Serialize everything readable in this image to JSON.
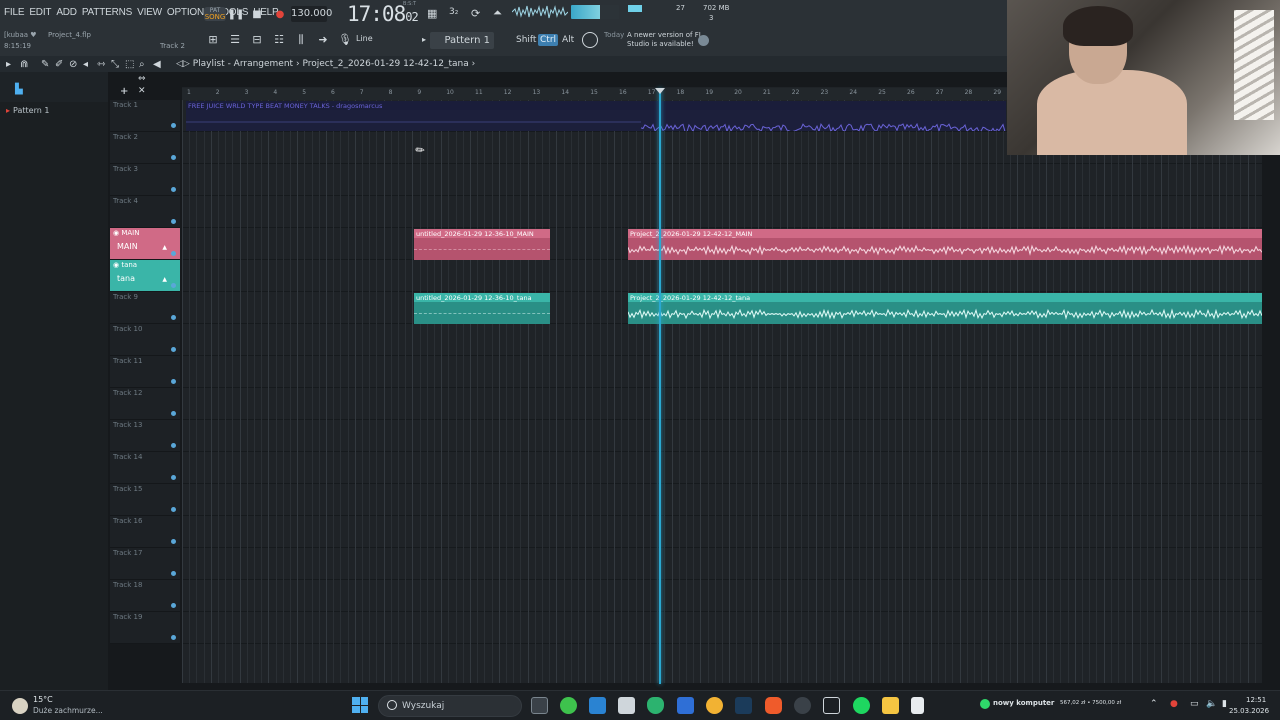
{
  "menu": [
    "FILE",
    "EDIT",
    "ADD",
    "PATTERNS",
    "VIEW",
    "OPTIONS",
    "TOOLS",
    "HELP"
  ],
  "transport": {
    "mode_top": "PAT",
    "mode_bottom": "SONG",
    "tempo": "130.000",
    "time_main": "17:08",
    "time_sub": "02",
    "time_caption": "B:S:T"
  },
  "stats": {
    "cpu": "27",
    "ram": "702 MB",
    "poly": "3"
  },
  "info": {
    "user": "[kubaa ♥",
    "project_file": "Project_4.flp",
    "time": "8:15:19",
    "track_hint": "Track 2"
  },
  "toolbar2": {
    "line_mode": "Line",
    "pattern": "Pattern 1",
    "shift": "Shift",
    "ctrl": "Ctrl",
    "alt": "Alt"
  },
  "news": {
    "day": "Today",
    "text": "A newer version of FL Studio is available!"
  },
  "playlist": {
    "title": "Playlist - Arrangement",
    "breadcrumb": "Project_2_2026-01-29 12-42-12_tana"
  },
  "browser": {
    "pattern_item": "Pattern 1"
  },
  "ruler": [
    "1",
    "2",
    "3",
    "4",
    "5",
    "6",
    "7",
    "8",
    "9",
    "10",
    "11",
    "12",
    "13",
    "14",
    "15",
    "16",
    "17",
    "18",
    "19",
    "20",
    "21",
    "22",
    "23",
    "24",
    "25",
    "26",
    "27",
    "28",
    "29"
  ],
  "tracks": [
    {
      "label": "Track 1",
      "kind": "plain"
    },
    {
      "label": "Track 2",
      "kind": "plain"
    },
    {
      "label": "Track 3",
      "kind": "plain"
    },
    {
      "label": "Track 4",
      "kind": "plain"
    },
    {
      "label": "MAIN",
      "sub": "MAIN",
      "kind": "main"
    },
    {
      "label": "tana",
      "sub": "tana",
      "kind": "tana"
    },
    {
      "label": "Track 9",
      "kind": "plain"
    },
    {
      "label": "Track 10",
      "kind": "plain"
    },
    {
      "label": "Track 11",
      "kind": "plain"
    },
    {
      "label": "Track 12",
      "kind": "plain"
    },
    {
      "label": "Track 13",
      "kind": "plain"
    },
    {
      "label": "Track 14",
      "kind": "plain"
    },
    {
      "label": "Track 15",
      "kind": "plain"
    },
    {
      "label": "Track 16",
      "kind": "plain"
    },
    {
      "label": "Track 17",
      "kind": "plain"
    },
    {
      "label": "Track 18",
      "kind": "plain"
    },
    {
      "label": "Track 19",
      "kind": "plain"
    }
  ],
  "clips": {
    "beat": "FREE JUICE WRLD TYPE BEAT MONEY TALKS - dragosmarcus",
    "main_a": "untitled_2026-01-29 12-36-10_MAIN",
    "main_b": "Project_2_2026-01-29 12-42-12_MAIN",
    "tana_a": "untitled_2026-01-29 12-36-10_tana",
    "tana_b": "Project_2_2026-01-29 12-42-12_tana"
  },
  "taskbar": {
    "temp": "15°C",
    "weather": "Duże zachmurze...",
    "search": "Wyszukaj",
    "system_label": "nowy komputer",
    "system_values": "567,02 zł • 7500,00 zł",
    "clock_time": "12:51",
    "clock_date": "25.03.2026"
  },
  "colors": {
    "main": "#d06a86",
    "tana": "#3ab5a8",
    "playhead": "#2aa8d0",
    "accent": "#f0a020"
  }
}
